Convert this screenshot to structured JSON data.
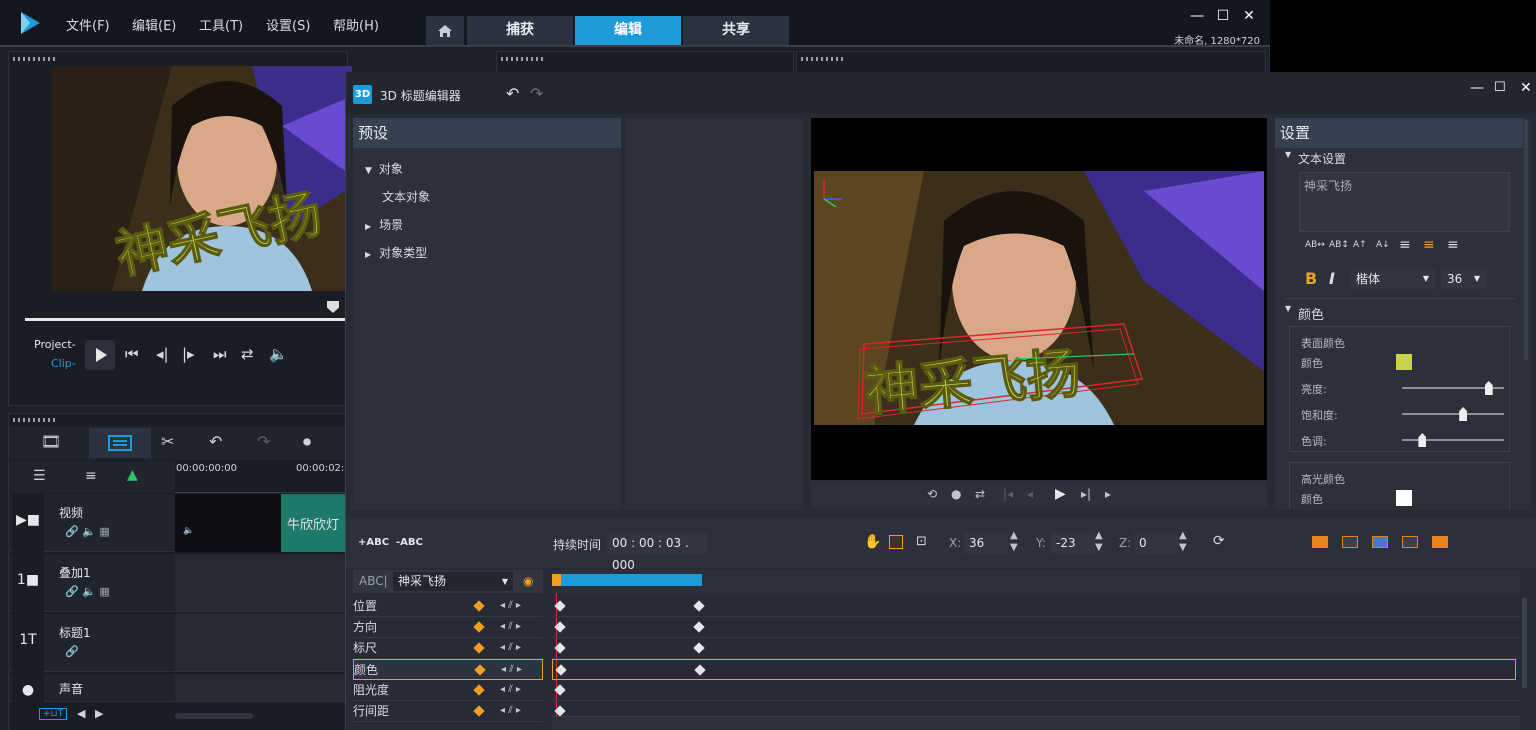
{
  "app": {
    "menu": [
      {
        "label": "文件(F)"
      },
      {
        "label": "编辑(E)"
      },
      {
        "label": "工具(T)"
      },
      {
        "label": "设置(S)"
      },
      {
        "label": "帮助(H)"
      }
    ],
    "tabs": [
      {
        "label": "捕获"
      },
      {
        "label": "编辑"
      },
      {
        "label": "共享"
      }
    ],
    "project_info": "未命名, 1280*720",
    "accent": "#1e9ad9"
  },
  "player": {
    "project_label": "Project-",
    "clip_label": "Clip-",
    "overlay_text": "神采飞扬"
  },
  "timeline": {
    "ruler": [
      "00:00:00:00",
      "00:00:02:0"
    ],
    "tracks": [
      {
        "name": "视频",
        "icon": "video-track-icon"
      },
      {
        "name": "叠加1",
        "icon": "overlay-track-icon"
      },
      {
        "name": "标题1",
        "icon": "title-track-icon"
      },
      {
        "name": "声音",
        "icon": "voice-track-icon"
      }
    ],
    "clip_text": "牛欣欣灯"
  },
  "editor": {
    "title": "3D 标题编辑器",
    "badge": "3D",
    "presets": {
      "header": "预设",
      "items": [
        {
          "label": "对象",
          "arrow": "▼"
        },
        {
          "label": "文本对象",
          "arrow": ""
        },
        {
          "label": "场景",
          "arrow": "▶"
        },
        {
          "label": "对象类型",
          "arrow": "▶"
        }
      ]
    },
    "preview_text": "神采飞扬",
    "settings": {
      "header": "设置",
      "text_section": "文本设置",
      "text_value": "神采飞扬",
      "font": "楷体",
      "size": "36",
      "color_section": "颜色",
      "surface_color": "表面颜色",
      "color_label": "颜色",
      "brightness_label": "亮度:",
      "saturation_label": "饱和度:",
      "hue_label": "色调:",
      "surface_swatch": "#c8d24a",
      "highlight_color": "高光颜色",
      "highlight_color_label": "颜色",
      "highlight_swatch": "#ffffff",
      "brightness": 0.85,
      "saturation": 0.6,
      "hue": 0.2,
      "format_buttons": [
        "AB↔",
        "AB↕",
        "A↑",
        "A↓"
      ],
      "bold": "B",
      "italic": "I"
    },
    "bottom": {
      "add_text": "+ABC",
      "remove_text": "-ABC",
      "duration_label": "持续时间",
      "duration_value": "00 : 00 : 03 . 000",
      "x_label": "X:",
      "x_value": "36",
      "y_label": "Y:",
      "y_value": "-23",
      "z_label": "Z:",
      "z_value": "0",
      "object_prefix": "ABC|",
      "object_select": "神采飞扬",
      "properties": [
        {
          "label": "位置"
        },
        {
          "label": "方向"
        },
        {
          "label": "标尺"
        },
        {
          "label": "颜色"
        },
        {
          "label": "阻光度"
        },
        {
          "label": "行间距"
        }
      ]
    }
  }
}
